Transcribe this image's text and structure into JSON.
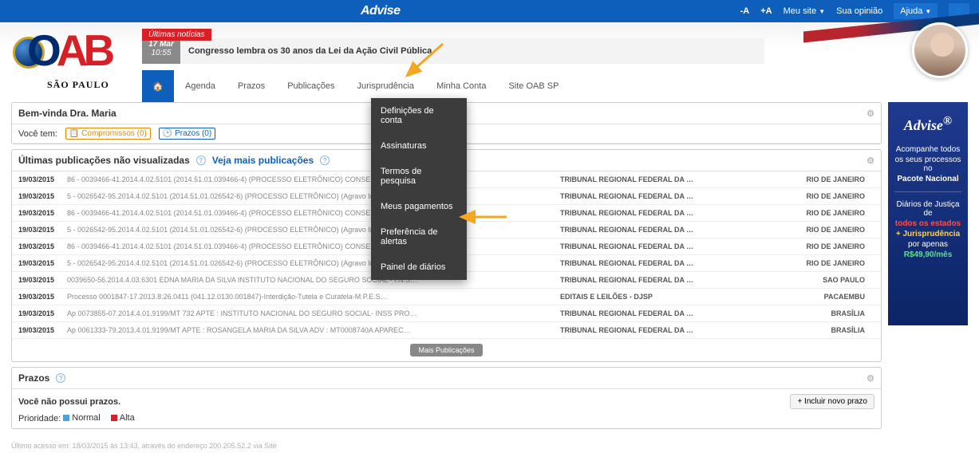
{
  "topbar": {
    "brand": "Advise",
    "font_dec": "-A",
    "font_inc": "+A",
    "my_site": "Meu site",
    "opinion": "Sua opinião",
    "help": "Ajuda"
  },
  "logo": {
    "sp": "SÃO PAULO"
  },
  "news": {
    "tag": "Últimas notícias",
    "date_day": "17 Mar",
    "date_time": "10:55",
    "title": "Congresso lembra os 30 anos da Lei da Ação Civil Pública"
  },
  "nav": {
    "agenda": "Agenda",
    "prazos": "Prazos",
    "publicacoes": "Publicações",
    "jurisprudencia": "Jurisprudência",
    "minha_conta": "Minha Conta",
    "site_oab": "Site OAB SP"
  },
  "dropdown": {
    "definicoes": "Definições de conta",
    "assinaturas": "Assinaturas",
    "termos": "Termos de pesquisa",
    "pagamentos": "Meus pagamentos",
    "alertas": "Preferência de alertas",
    "painel": "Painel de diários"
  },
  "welcome": {
    "title": "Bem-vinda Dra. Maria",
    "you_have": "Você tem:",
    "compromissos": "Compromissos (0)",
    "prazos": "Prazos (0)"
  },
  "pubs": {
    "title": "Últimas publicações não visualizadas",
    "link": "Veja mais publicações",
    "more": "Mais Publicações",
    "rows": [
      {
        "date": "19/03/2015",
        "desc": "86 - 0039466-41.2014.4.02.5101 (2014.51.01.039466-4) (PROCESSO ELETRÔNICO) CONSELHO REGI…",
        "trib": "TRIBUNAL REGIONAL FEDERAL DA …",
        "loc": "RIO DE JANEIRO"
      },
      {
        "date": "19/03/2015",
        "desc": "5 - 0026542-95.2014.4.02.5101 (2014.51.01.026542-6) (PROCESSO ELETRÔNICO) (Agravo Interno) 2…",
        "trib": "TRIBUNAL REGIONAL FEDERAL DA …",
        "loc": "RIO DE JANEIRO"
      },
      {
        "date": "19/03/2015",
        "desc": "86 - 0039466-41.2014.4.02.5101 (2014.51.01.039466-4) (PROCESSO ELETRÔNICO) CONSELHO REGI…",
        "trib": "TRIBUNAL REGIONAL FEDERAL DA …",
        "loc": "RIO DE JANEIRO"
      },
      {
        "date": "19/03/2015",
        "desc": "5 - 0026542-95.2014.4.02.5101 (2014.51.01.026542-6) (PROCESSO ELETRÔNICO) (Agravo Interno) 2…",
        "trib": "TRIBUNAL REGIONAL FEDERAL DA …",
        "loc": "RIO DE JANEIRO"
      },
      {
        "date": "19/03/2015",
        "desc": "86 - 0039466-41.2014.4.02.5101 (2014.51.01.039466-4) (PROCESSO ELETRÔNICO) CONSELHO REGI…",
        "trib": "TRIBUNAL REGIONAL FEDERAL DA …",
        "loc": "RIO DE JANEIRO"
      },
      {
        "date": "19/03/2015",
        "desc": "5 - 0026542-95.2014.4.02.5101 (2014.51.01.026542-6) (PROCESSO ELETRÔNICO) (Agravo Interno) 2…",
        "trib": "TRIBUNAL REGIONAL FEDERAL DA …",
        "loc": "RIO DE JANEIRO"
      },
      {
        "date": "19/03/2015",
        "desc": "0039650-56.2014.4.03.6301 EDNA MARIA DA SILVA INSTITUTO NACIONAL DO SEGURO SOCIAL - I.N.S…",
        "trib": "TRIBUNAL REGIONAL FEDERAL DA …",
        "loc": "SAO PAULO"
      },
      {
        "date": "19/03/2015",
        "desc": "Processo 0001847-17.2013.8.26.0411 (041.12.0130.001847)-Interdição-Tutela e Curatela-M.P.E.S…",
        "trib": "EDITAIS E LEILÕES - DJSP",
        "loc": "PACAEMBU"
      },
      {
        "date": "19/03/2015",
        "desc": "Ap 0073855-07.2014.4.01.9199/MT 732 APTE : INSTITUTO NACIONAL DO SEGURO SOCIAL- INSS PRO…",
        "trib": "TRIBUNAL REGIONAL FEDERAL DA …",
        "loc": "BRASÍLIA"
      },
      {
        "date": "19/03/2015",
        "desc": "Ap 0061333-79.2013.4.01.9199/MT APTE : ROSANGELA MARIA DA SILVA ADV : MT0008740A APAREC…",
        "trib": "TRIBUNAL REGIONAL FEDERAL DA …",
        "loc": "BRASÍLIA"
      }
    ]
  },
  "prazos_panel": {
    "title": "Prazos",
    "empty": "Você não possui prazos.",
    "btn": "+ Incluir novo prazo",
    "prio_label": "Prioridade:",
    "normal": "Normal",
    "alta": "Alta"
  },
  "ad": {
    "brand": "Advise",
    "l1": "Acompanhe todos",
    "l2": "os seus processos no",
    "l3": "Pacote Nacional",
    "l4": "Diários de Justiça de",
    "l5": "todos os estados",
    "l6": "+ Jurisprudência",
    "l7": "por apenas",
    "l8": "R$49,90/mês"
  },
  "footer": "Último acesso em: 18/03/2015 às 13:43, através do endereço 200.205.52.2 via Site"
}
